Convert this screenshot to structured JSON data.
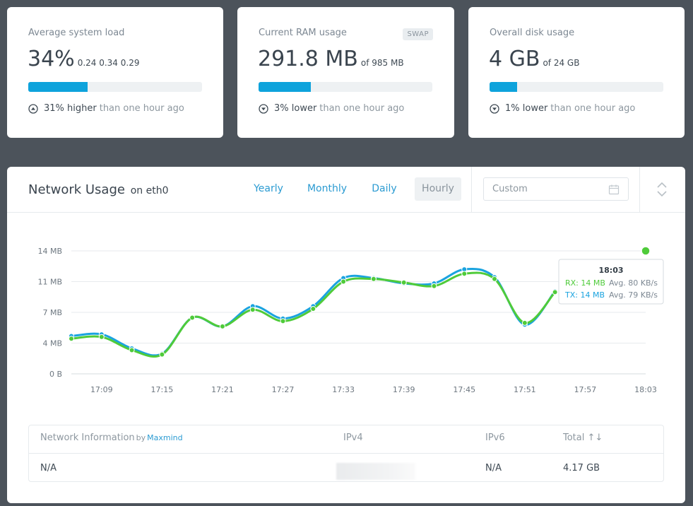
{
  "stats": [
    {
      "title": "Average system load",
      "value": "34%",
      "sub": "0.24 0.34 0.29",
      "fraction": 0.34,
      "trend_dir": "up",
      "trend_value": "31% higher",
      "trend_text": "than one hour ago"
    },
    {
      "title": "Current RAM usage",
      "badge": "SWAP",
      "value": "291.8 MB",
      "sub": "of 985 MB",
      "fraction": 0.3,
      "trend_dir": "down",
      "trend_value": "3% lower",
      "trend_text": "than one hour ago"
    },
    {
      "title": "Overall disk usage",
      "value": "4 GB",
      "sub": "of 24 GB",
      "fraction": 0.16,
      "trend_dir": "down",
      "trend_value": "1% lower",
      "trend_text": "than one hour ago"
    }
  ],
  "network": {
    "title": "Network Usage",
    "interface": "on eth0",
    "tabs": [
      "Yearly",
      "Monthly",
      "Daily",
      "Hourly"
    ],
    "active_tab": "Hourly",
    "custom_placeholder": "Custom",
    "tooltip": {
      "time": "18:03",
      "rx_label": "RX: 14 MB",
      "rx_avg": "Avg. 80 KB/s",
      "tx_label": "TX: 14 MB",
      "tx_avg": "Avg. 79 KB/s"
    },
    "table": {
      "headers": {
        "info": "Network Information",
        "by": "by",
        "provider": "Maxmind",
        "ipv4": "IPv4",
        "ipv6": "IPv6",
        "total": "Total ↑↓"
      },
      "row": {
        "info": "N/A",
        "ipv4": "",
        "ipv6": "N/A",
        "total": "4.17 GB"
      }
    }
  },
  "colors": {
    "tx": "#1aa3df",
    "rx": "#4fcb3a",
    "bar": "#0ea3dc",
    "link": "#2b9bd2"
  },
  "chart_data": {
    "type": "line",
    "x": [
      "17:06",
      "17:09",
      "17:12",
      "17:15",
      "17:18",
      "17:21",
      "17:24",
      "17:27",
      "17:30",
      "17:33",
      "17:36",
      "17:39",
      "17:42",
      "17:45",
      "17:48",
      "17:51",
      "17:54",
      "17:57",
      "18:00",
      "18:03"
    ],
    "x_ticks": [
      "17:09",
      "17:15",
      "17:21",
      "17:27",
      "17:33",
      "17:39",
      "17:45",
      "17:51",
      "17:57",
      "18:03"
    ],
    "y_ticks": [
      "0 B",
      "4 MB",
      "7 MB",
      "11 MB",
      "14 MB"
    ],
    "ylim": [
      0,
      14
    ],
    "series": [
      {
        "name": "TX",
        "color": "#1aa3df",
        "values": [
          4.3,
          4.5,
          2.9,
          2.3,
          6.4,
          5.4,
          7.7,
          6.3,
          7.7,
          10.9,
          10.9,
          10.3,
          10.3,
          11.9,
          11.0,
          5.6,
          9.4,
          null,
          null,
          14
        ]
      },
      {
        "name": "RX",
        "color": "#4fcb3a",
        "values": [
          4.0,
          4.2,
          2.7,
          2.2,
          6.4,
          5.4,
          7.3,
          6.0,
          7.4,
          10.5,
          10.8,
          10.4,
          10.0,
          11.4,
          10.8,
          5.8,
          9.3,
          null,
          null,
          14
        ]
      }
    ]
  }
}
